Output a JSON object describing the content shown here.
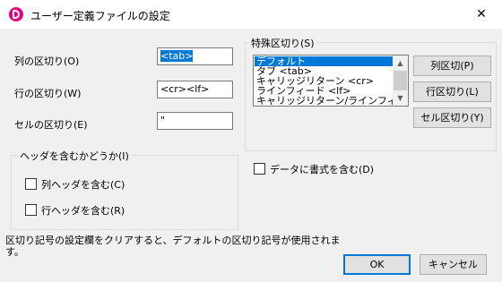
{
  "window": {
    "title": "ユーザー定義ファイルの設定",
    "close_glyph": "✕"
  },
  "delimiters": {
    "column_label": "列の区切り(O)",
    "column_value": "<tab>",
    "row_label": "行の区切り(W)",
    "row_value": "<cr><lf>",
    "cell_label": "セルの区切り(E)",
    "cell_value": "\""
  },
  "header_group": {
    "title": "ヘッダを含むかどうか(I)",
    "column_header_label": "列ヘッダを含む(C)",
    "column_header_checked": false,
    "row_header_label": "行ヘッダを含む(R)",
    "row_header_checked": false
  },
  "special_delimiters": {
    "title": "特殊区切り(S)",
    "items": [
      "デフォルト",
      "タブ <tab>",
      "キャリッジリターン <cr>",
      "ラインフィード <lf>",
      "キャリッジリターン/ラインフィード <cr><lf>"
    ],
    "selected_index": 0,
    "column_button": "列区切(P)",
    "row_button": "行区切り(L)",
    "cell_button": "セル区切り(Y)"
  },
  "format_option": {
    "label": "データに書式を含む(D)",
    "checked": false
  },
  "message": "区切り記号の設定欄をクリアすると、デフォルトの区切り記号が使用されます。",
  "buttons": {
    "ok": "OK",
    "cancel": "キャンセル"
  },
  "colors": {
    "accent": "#0078d7",
    "app_icon": "#e4007f"
  }
}
